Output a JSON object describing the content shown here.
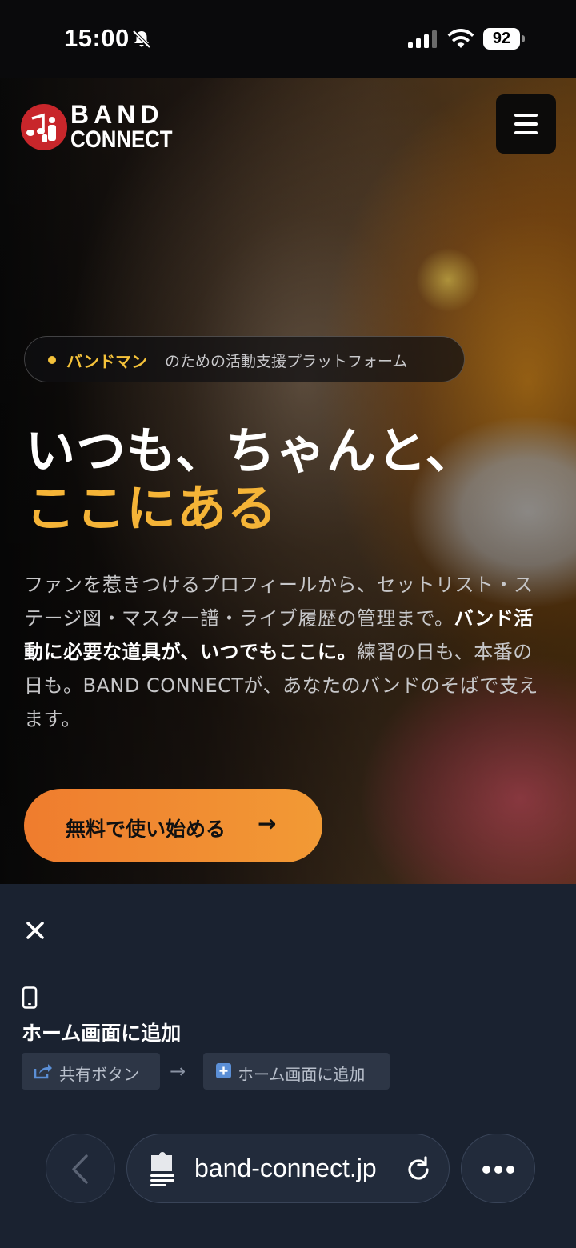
{
  "status_bar": {
    "time": "15:00",
    "battery": "92"
  },
  "hero": {
    "logo": {
      "line1": "BAND",
      "line2": "CONNECT"
    },
    "tagline": {
      "highlight": "バンドマン",
      "rest": "のための活動支援プラットフォーム"
    },
    "headline": {
      "line1": "いつも、ちゃんと、",
      "line2": "ここにある"
    },
    "lead": {
      "part1": "ファンを惹きつけるプロフィールから、セットリスト・ステージ図・マスター譜・ライブ履歴の管理まで。",
      "bold": "バンド活動に必要な道具が、いつでもここに。",
      "part2": "練習の日も、本番の日も。BAND CONNECTが、あなたのバンドのそばで支えます。"
    },
    "cta": {
      "label": "無料で使い始める",
      "arrow": "→"
    }
  },
  "add_to_home_sheet": {
    "title": "ホーム画面に追加",
    "step1": "共有ボタン",
    "step_arrow": "→",
    "step2": "ホーム画面に追加"
  },
  "browser": {
    "url": "band-connect.jp"
  },
  "colors": {
    "accent_yellow": "#f5b437",
    "cta_orange": "#ef7c2e",
    "logo_red": "#c8262b",
    "sheet_bg": "#1a2230"
  },
  "icons": [
    "bell-off-icon",
    "signal-icon",
    "wifi-icon",
    "battery-icon",
    "hamburger-menu-icon",
    "close-icon",
    "phone-icon",
    "share-icon",
    "plus-square-icon",
    "chevron-left-icon",
    "page-icon",
    "reload-icon",
    "more-icon"
  ]
}
